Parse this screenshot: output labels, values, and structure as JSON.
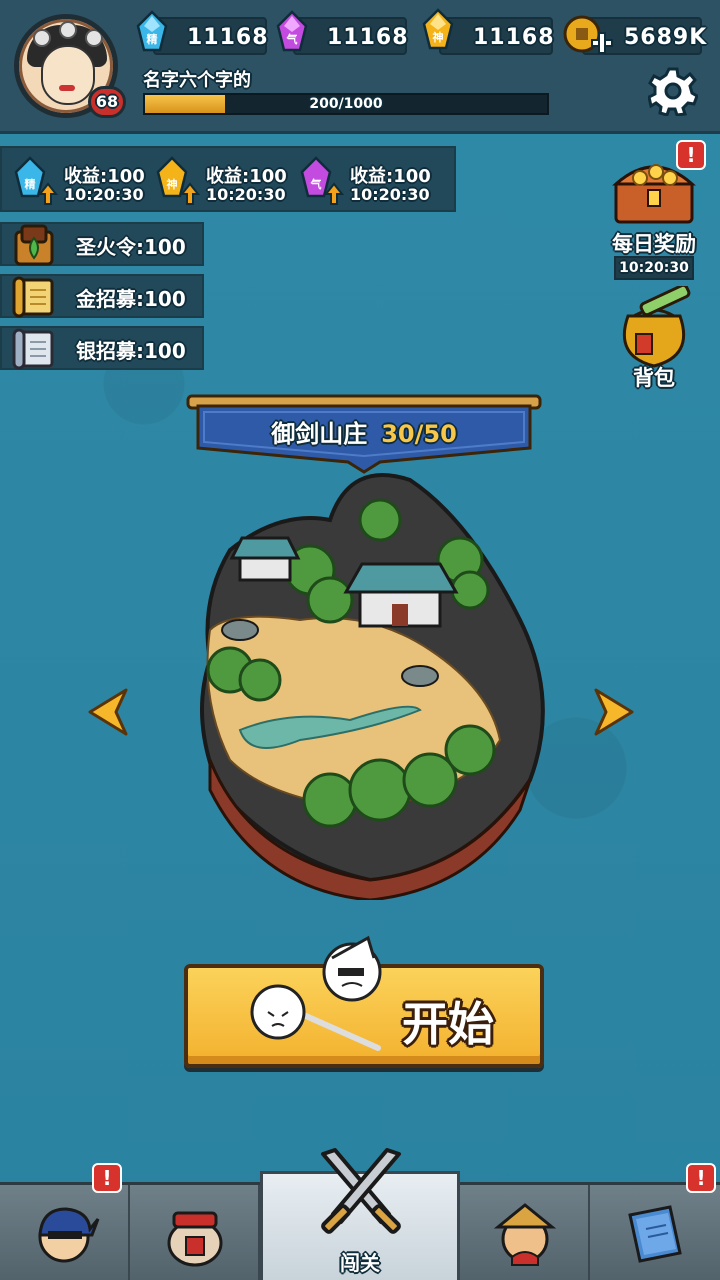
{
  "player": {
    "name": "名字六个字的",
    "level": "68",
    "xp_text": "200/1000",
    "xp_fraction": 0.2
  },
  "resources": [
    {
      "icon": "jing-crystal-icon",
      "glyph": "精",
      "color": "#3ab6e8",
      "value": "11168"
    },
    {
      "icon": "qi-crystal-icon",
      "glyph": "气",
      "color": "#c44be0",
      "value": "11168"
    },
    {
      "icon": "shen-crystal-icon",
      "glyph": "神",
      "color": "#f4b318",
      "value": "11168"
    },
    {
      "icon": "coin-plus-icon",
      "glyph": "",
      "color": "#e9a91c",
      "value": "5689K"
    }
  ],
  "income": [
    {
      "glyph": "精",
      "color": "#3ab6e8",
      "label": "收益:100",
      "time": "10:20:30"
    },
    {
      "glyph": "神",
      "color": "#f4b318",
      "label": "收益:100",
      "time": "10:20:30"
    },
    {
      "glyph": "气",
      "color": "#c44be0",
      "label": "收益:100",
      "time": "10:20:30"
    }
  ],
  "items": [
    {
      "label": "圣火令:100",
      "icon": "fire-token-icon"
    },
    {
      "label": "金招募:100",
      "icon": "gold-scroll-icon"
    },
    {
      "label": "银招募:100",
      "icon": "silver-scroll-icon"
    }
  ],
  "daily_reward": {
    "label": "每日奖励",
    "time": "10:20:30",
    "alert": "!"
  },
  "backpack": {
    "label": "背包"
  },
  "stage": {
    "name": "御剑山庄",
    "progress": "30/50"
  },
  "start_button": {
    "label": "开始"
  },
  "nav": {
    "tabs": [
      {
        "name": "hero",
        "icon": "ninja-hero-icon",
        "label": "",
        "alert": "!"
      },
      {
        "name": "tavern",
        "icon": "wine-jar-icon",
        "label": ""
      },
      {
        "name": "stage",
        "icon": "crossed-swords-icon",
        "label": "闯关"
      },
      {
        "name": "rank",
        "icon": "warrior-face-icon",
        "label": ""
      },
      {
        "name": "book",
        "icon": "book-icon",
        "label": "",
        "alert": "!"
      }
    ]
  }
}
